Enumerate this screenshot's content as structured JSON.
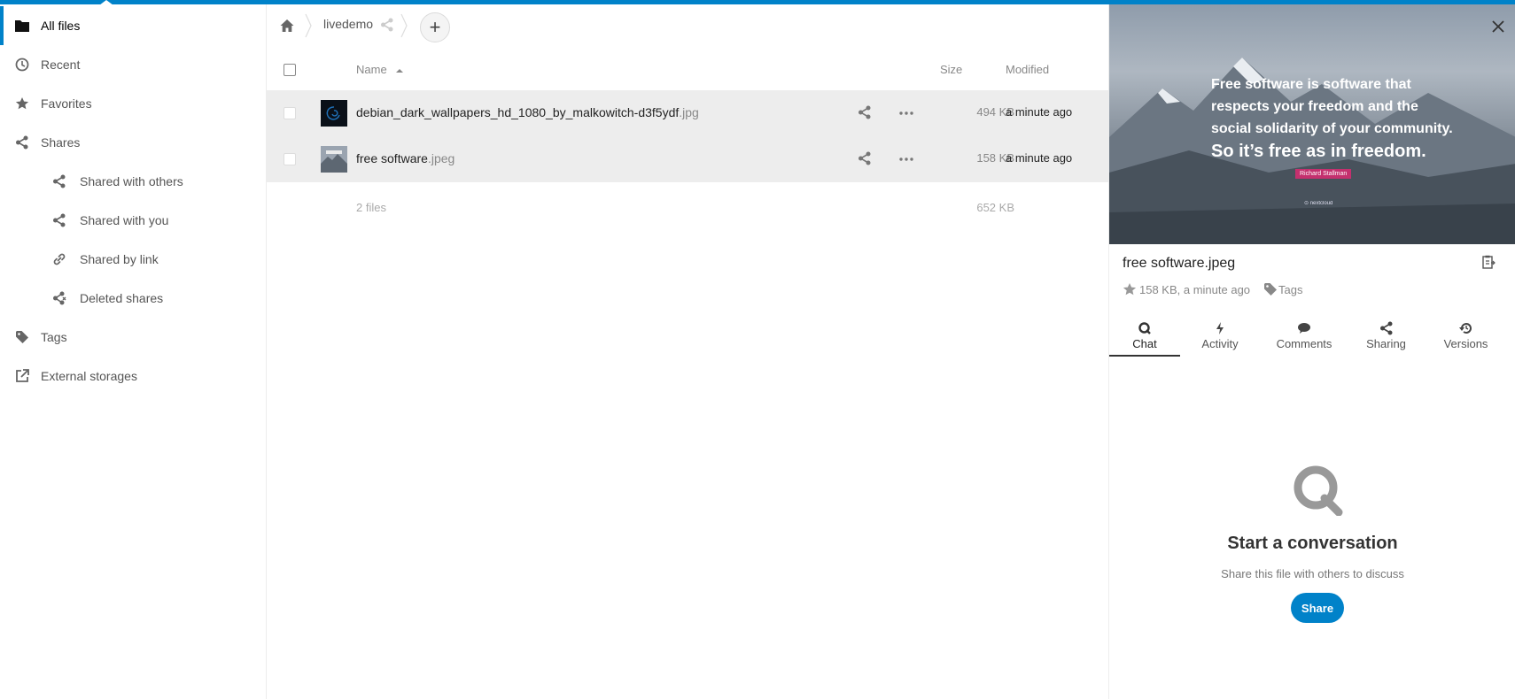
{
  "colors": {
    "accent": "#0082c9",
    "row_highlight": "#ededed",
    "tag": "#c4306e"
  },
  "sidebar": {
    "items": [
      {
        "label": "All files",
        "icon": "folder-icon",
        "active": true
      },
      {
        "label": "Recent",
        "icon": "clock-icon"
      },
      {
        "label": "Favorites",
        "icon": "star-icon"
      },
      {
        "label": "Shares",
        "icon": "share-icon"
      },
      {
        "label": "Shared with others",
        "icon": "share-icon",
        "sub": true
      },
      {
        "label": "Shared with you",
        "icon": "share-icon",
        "sub": true
      },
      {
        "label": "Shared by link",
        "icon": "link-icon",
        "sub": true
      },
      {
        "label": "Deleted shares",
        "icon": "deleted-share-icon",
        "sub": true
      },
      {
        "label": "Tags",
        "icon": "tag-icon"
      },
      {
        "label": "External storages",
        "icon": "external-icon"
      }
    ]
  },
  "breadcrumb": {
    "folder": "livedemo",
    "home_icon": "home-icon",
    "add_label": "+"
  },
  "table": {
    "headers": {
      "name": "Name",
      "size": "Size",
      "modified": "Modified"
    },
    "rows": [
      {
        "base": "debian_dark_wallpapers_hd_1080_by_malkowitch-d3f5ydf",
        "ext": ".jpg",
        "size": "494 KB",
        "modified": "a minute ago"
      },
      {
        "base": "free software",
        "ext": ".jpeg",
        "size": "158 KB",
        "modified": "a minute ago"
      }
    ],
    "summary": {
      "count": "2 files",
      "total": "652 KB"
    }
  },
  "details": {
    "preview": {
      "line1": "Free software is software that",
      "line2": "respects your freedom and the",
      "line3": "social solidarity of your community.",
      "line4": "So it’s free as in freedom.",
      "author": "Richard Stallman",
      "small": "⊙ nextcloud"
    },
    "filename": "free software.jpeg",
    "meta": "158 KB, a minute ago",
    "tags_label": "Tags",
    "tabs": [
      {
        "label": "Chat",
        "icon": "chat-icon",
        "active": true
      },
      {
        "label": "Activity",
        "icon": "activity-icon"
      },
      {
        "label": "Comments",
        "icon": "comments-icon"
      },
      {
        "label": "Sharing",
        "icon": "share-icon"
      },
      {
        "label": "Versions",
        "icon": "history-icon"
      }
    ],
    "empty": {
      "title": "Start a conversation",
      "subtitle": "Share this file with others to discuss",
      "button": "Share"
    }
  }
}
